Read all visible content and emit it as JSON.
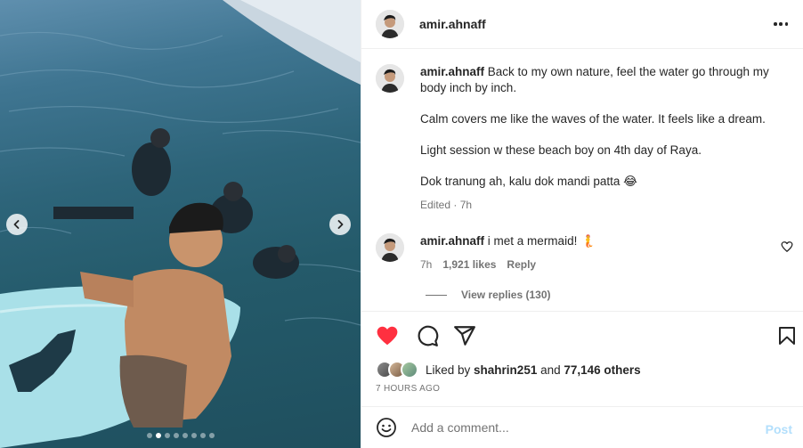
{
  "post": {
    "username": "amir.ahnaff",
    "caption_paragraphs": [
      "Back to my own nature, feel the water go through my body inch by inch.",
      "Calm covers me like the waves of the water. It feels like a dream.",
      "Light session w these beach boy on 4th day of Raya.",
      "Dok tranung ah, kalu dok mandi patta 😂"
    ],
    "caption_meta": "Edited · 7h"
  },
  "comment": {
    "username": "amir.ahnaff",
    "text": "i met a mermaid! 🧜",
    "time": "7h",
    "likes": "1,921 likes",
    "reply": "Reply",
    "view_replies": "View replies (130)"
  },
  "likes": {
    "prefix": "Liked by ",
    "user": "shahrin251",
    "middle": " and ",
    "others": "77,146 others"
  },
  "timestamp": "7 HOURS AGO",
  "add_comment": {
    "placeholder": "Add a comment...",
    "post_label": "Post"
  },
  "carousel": {
    "slide_count": 8,
    "active_index": 1
  },
  "icons": {
    "like": "heart-filled-icon",
    "comment": "comment-icon",
    "share": "share-icon",
    "save": "bookmark-icon",
    "more": "more-dots-icon",
    "emoji": "emoji-icon"
  },
  "colors": {
    "like_red": "#ff3040",
    "post_blue_disabled": "#b2dffc",
    "text": "#262626",
    "muted": "#737373"
  }
}
